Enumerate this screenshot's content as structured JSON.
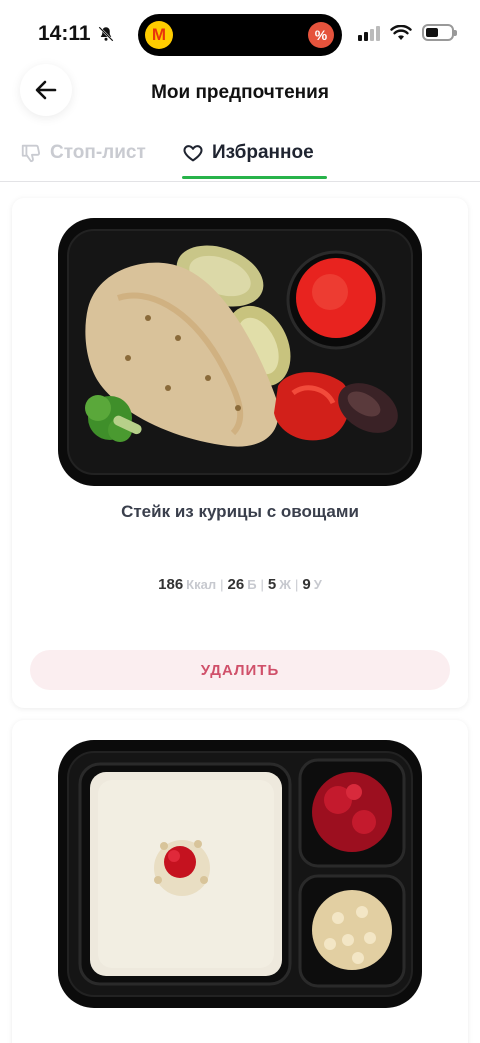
{
  "status_bar": {
    "time": "14:11",
    "island_left_glyph": "M",
    "island_right_glyph": "%"
  },
  "header": {
    "title": "Мои предпочтения",
    "back_icon": "arrow-left-icon"
  },
  "tabs": [
    {
      "label": "Стоп-лист",
      "icon": "thumbs-down-icon",
      "active": false
    },
    {
      "label": "Избранное",
      "icon": "heart-icon",
      "active": true
    }
  ],
  "colors": {
    "accent": "#27b34a",
    "delete_bg": "#fbeef0",
    "delete_text": "#d0506a"
  },
  "cards": [
    {
      "name": "Стейк из курицы с овощами",
      "image": "chicken-steak-with-vegetables-tray",
      "kcal": "186",
      "kcal_unit": "Ккал",
      "protein": "26",
      "protein_unit": "Б",
      "fat": "5",
      "fat_unit": "Ж",
      "carbs": "9",
      "carbs_unit": "У",
      "delete_label": "УДАЛИТЬ"
    },
    {
      "image": "rice-porridge-with-berries-and-nuts-tray"
    }
  ]
}
